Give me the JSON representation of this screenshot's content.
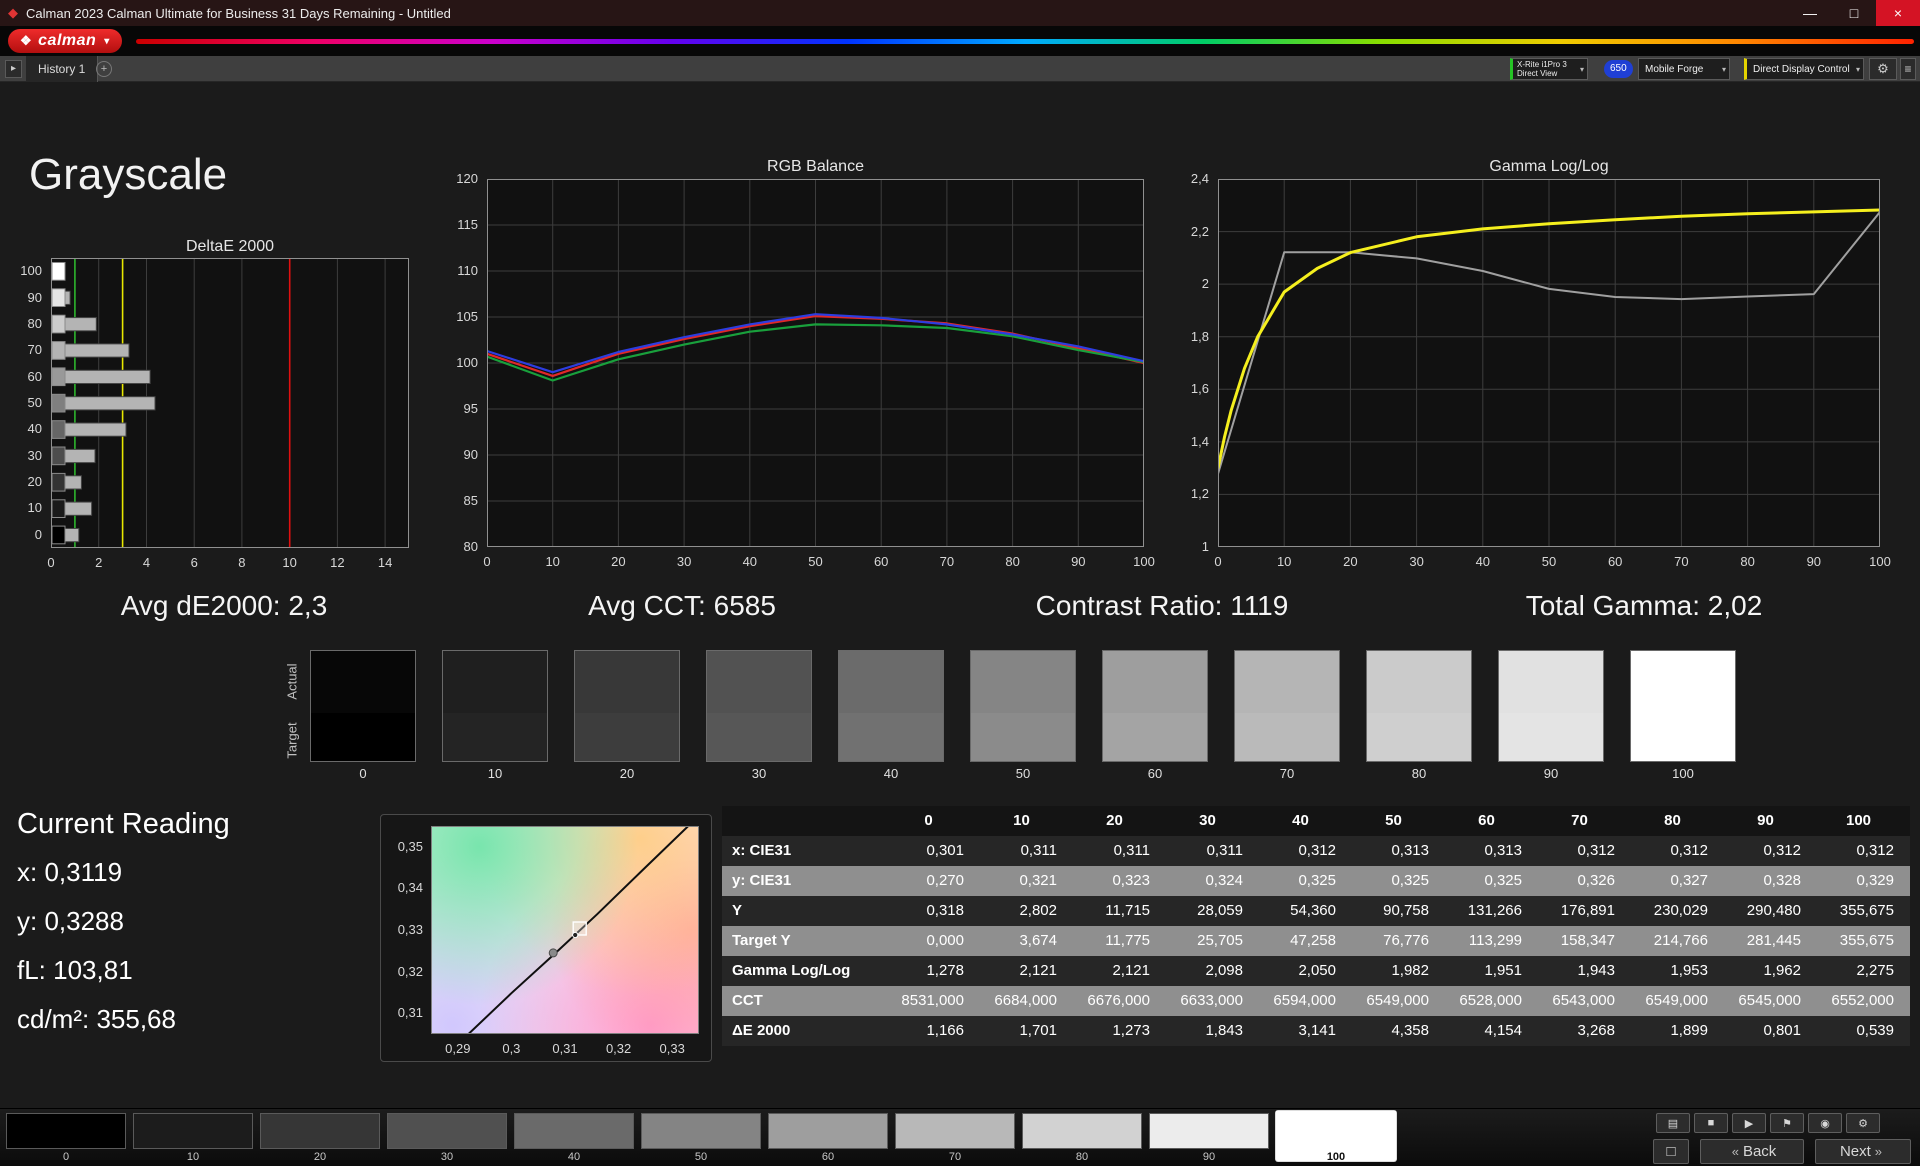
{
  "window": {
    "title": "Calman 2023 Calman Ultimate for Business 31 Days Remaining  - Untitled",
    "icon_glyph": "◆",
    "minimize_glyph": "—",
    "maximize_glyph": "□",
    "close_glyph": "×"
  },
  "brand": {
    "logo_text": "calman",
    "logo_icon": "❖",
    "logo_color": "#d11a1a",
    "dropdown_glyph": "▾"
  },
  "tabbar": {
    "nav_glyph": "▸",
    "history_tab": "History 1",
    "add_glyph": "+",
    "meter_line1": "X-Rite i1Pro 3",
    "meter_line2": "Direct View",
    "meter_accent": "#25c325",
    "badge": "650",
    "source_label": "Mobile Forge",
    "display_control_label": "Direct Display Control",
    "display_control_accent": "#e4d300",
    "dropdown_glyph": "▾",
    "gear_glyph": "⚙",
    "menu_glyph": "≡"
  },
  "page": {
    "title": "Grayscale"
  },
  "summary": {
    "de2000": "Avg dE2000: 2,3",
    "cct": "Avg CCT: 6585",
    "contrast": "Contrast Ratio: 1119",
    "gamma": "Total Gamma: 2,02"
  },
  "current_reading": {
    "title": "Current Reading",
    "x": "x: 0,3119",
    "y": "y: 0,3288",
    "fl": "fL: 103,81",
    "cdm2": "cd/m²: 355,68"
  },
  "swatches": {
    "row_labels": [
      "Actual",
      "Target"
    ],
    "items": [
      {
        "label": "0",
        "actual": "#070707",
        "target": "#000000"
      },
      {
        "label": "10",
        "actual": "#1f1f1f",
        "target": "#242424"
      },
      {
        "label": "20",
        "actual": "#383838",
        "target": "#3d3d3d"
      },
      {
        "label": "30",
        "actual": "#525252",
        "target": "#575757"
      },
      {
        "label": "40",
        "actual": "#6b6b6b",
        "target": "#717171"
      },
      {
        "label": "50",
        "actual": "#858585",
        "target": "#8b8b8b"
      },
      {
        "label": "60",
        "actual": "#9e9e9e",
        "target": "#a4a4a4"
      },
      {
        "label": "70",
        "actual": "#b5b5b5",
        "target": "#bababa"
      },
      {
        "label": "80",
        "actual": "#cbcbcb",
        "target": "#cfcfcf"
      },
      {
        "label": "90",
        "actual": "#e1e1e1",
        "target": "#e4e4e4"
      },
      {
        "label": "100",
        "actual": "#ffffff",
        "target": "#ffffff"
      }
    ]
  },
  "table": {
    "columns": [
      "0",
      "10",
      "20",
      "30",
      "40",
      "50",
      "60",
      "70",
      "80",
      "90",
      "100"
    ],
    "rows": [
      {
        "label": "x: CIE31",
        "values": [
          "0,301",
          "0,311",
          "0,311",
          "0,311",
          "0,312",
          "0,313",
          "0,313",
          "0,312",
          "0,312",
          "0,312",
          "0,312"
        ]
      },
      {
        "label": "y: CIE31",
        "values": [
          "0,270",
          "0,321",
          "0,323",
          "0,324",
          "0,325",
          "0,325",
          "0,325",
          "0,326",
          "0,327",
          "0,328",
          "0,329"
        ]
      },
      {
        "label": "Y",
        "values": [
          "0,318",
          "2,802",
          "11,715",
          "28,059",
          "54,360",
          "90,758",
          "131,266",
          "176,891",
          "230,029",
          "290,480",
          "355,675"
        ]
      },
      {
        "label": "Target Y",
        "values": [
          "0,000",
          "3,674",
          "11,775",
          "25,705",
          "47,258",
          "76,776",
          "113,299",
          "158,347",
          "214,766",
          "281,445",
          "355,675"
        ]
      },
      {
        "label": "Gamma Log/Log",
        "values": [
          "1,278",
          "2,121",
          "2,121",
          "2,098",
          "2,050",
          "1,982",
          "1,951",
          "1,943",
          "1,953",
          "1,962",
          "2,275"
        ]
      },
      {
        "label": "CCT",
        "values": [
          "8531,000",
          "6684,000",
          "6676,000",
          "6633,000",
          "6594,000",
          "6549,000",
          "6528,000",
          "6543,000",
          "6549,000",
          "6545,000",
          "6552,000"
        ]
      },
      {
        "label": "ΔE 2000",
        "values": [
          "1,166",
          "1,701",
          "1,273",
          "1,843",
          "3,141",
          "4,358",
          "4,154",
          "3,268",
          "1,899",
          "0,801",
          "0,539"
        ]
      }
    ]
  },
  "bottom_bar": {
    "patches": [
      {
        "label": "0",
        "color": "#000000"
      },
      {
        "label": "10",
        "color": "#1c1c1c"
      },
      {
        "label": "20",
        "color": "#363636"
      },
      {
        "label": "30",
        "color": "#505050"
      },
      {
        "label": "40",
        "color": "#6a6a6a"
      },
      {
        "label": "50",
        "color": "#848484"
      },
      {
        "label": "60",
        "color": "#9e9e9e"
      },
      {
        "label": "70",
        "color": "#b8b8b8"
      },
      {
        "label": "80",
        "color": "#d2d2d2"
      },
      {
        "label": "90",
        "color": "#ececec"
      },
      {
        "label": "100",
        "color": "#ffffff",
        "selected": true
      }
    ],
    "icons": [
      {
        "name": "patch-grid",
        "glyph": "▤"
      },
      {
        "name": "stop",
        "glyph": "■"
      },
      {
        "name": "play",
        "glyph": "▶"
      },
      {
        "name": "flag",
        "glyph": "⚑"
      },
      {
        "name": "record",
        "glyph": "◉"
      },
      {
        "name": "settings",
        "glyph": "⚙"
      }
    ],
    "window_button_glyph": "□",
    "back_icon": "«",
    "back_label": "Back",
    "next_label": "Next",
    "next_icon": "»"
  },
  "chart_data": [
    {
      "id": "deltae",
      "type": "bar",
      "orientation": "horizontal",
      "title": "DeltaE 2000",
      "categories": [
        100,
        90,
        80,
        70,
        60,
        50,
        40,
        30,
        20,
        10,
        0
      ],
      "values": [
        0.539,
        0.801,
        1.899,
        3.268,
        4.154,
        4.358,
        3.141,
        1.843,
        1.273,
        1.701,
        1.166
      ],
      "xlim": [
        0,
        15
      ],
      "xticks": [
        0,
        2,
        4,
        6,
        8,
        10,
        12,
        14
      ],
      "reference_lines": [
        {
          "x": 1,
          "color": "#2db52d"
        },
        {
          "x": 3,
          "color": "#e8e800"
        },
        {
          "x": 10,
          "color": "#e01010"
        }
      ]
    },
    {
      "id": "rgb_balance",
      "type": "line",
      "title": "RGB Balance",
      "x": [
        0,
        10,
        20,
        30,
        40,
        50,
        60,
        70,
        80,
        90,
        100
      ],
      "ylim": [
        80,
        120
      ],
      "yticks": [
        80,
        85,
        90,
        95,
        100,
        105,
        110,
        115,
        120
      ],
      "series": [
        {
          "name": "Red",
          "color": "#e02828",
          "stroke_width": 2.2,
          "values": [
            101.0,
            98.6,
            101.0,
            102.6,
            104.0,
            105.1,
            104.8,
            104.3,
            103.2,
            101.6,
            100.0
          ]
        },
        {
          "name": "Green",
          "color": "#19a03c",
          "stroke_width": 2.2,
          "values": [
            100.7,
            98.1,
            100.4,
            102.0,
            103.4,
            104.2,
            104.1,
            103.8,
            102.9,
            101.4,
            100.1
          ]
        },
        {
          "name": "Blue",
          "color": "#2d3de0",
          "stroke_width": 2.2,
          "values": [
            101.3,
            99.0,
            101.2,
            102.8,
            104.2,
            105.3,
            104.9,
            104.2,
            103.1,
            101.8,
            100.2
          ]
        }
      ]
    },
    {
      "id": "gamma",
      "type": "line",
      "title": "Gamma Log/Log",
      "x": [
        0,
        10,
        20,
        30,
        40,
        50,
        60,
        70,
        80,
        90,
        100
      ],
      "ylim": [
        1,
        2.4
      ],
      "yticks": [
        1,
        1.2,
        1.4,
        1.6,
        1.8,
        2,
        2.2,
        2.4
      ],
      "ytick_labels": [
        "1",
        "1,2",
        "1,4",
        "1,6",
        "1,8",
        "2",
        "2,2",
        "2,4"
      ],
      "series": [
        {
          "name": "Measured Gamma",
          "color": "#a0a0a0",
          "stroke_width": 2,
          "values": [
            1.278,
            2.121,
            2.121,
            2.098,
            2.05,
            1.982,
            1.951,
            1.943,
            1.953,
            1.962,
            2.275
          ]
        },
        {
          "name": "Target Gamma",
          "color": "#f5ef1e",
          "stroke_width": 3,
          "x": [
            0,
            1,
            2,
            4,
            6,
            10,
            15,
            20,
            30,
            40,
            50,
            60,
            70,
            80,
            90,
            100
          ],
          "values": [
            1.3,
            1.42,
            1.52,
            1.68,
            1.8,
            1.97,
            2.06,
            2.12,
            2.18,
            2.21,
            2.23,
            2.245,
            2.258,
            2.268,
            2.275,
            2.282
          ]
        }
      ]
    },
    {
      "id": "cie_chromaticity",
      "type": "scatter",
      "title": "",
      "xlim": [
        0.285,
        0.335
      ],
      "ylim": [
        0.305,
        0.355
      ],
      "xticks": [
        0.29,
        0.3,
        0.31,
        0.32,
        0.33
      ],
      "xtick_labels": [
        "0,29",
        "0,3",
        "0,31",
        "0,32",
        "0,33"
      ],
      "yticks": [
        0.31,
        0.32,
        0.33,
        0.34,
        0.35
      ],
      "ytick_labels": [
        "0,31",
        "0,32",
        "0,33",
        "0,34",
        "0,35"
      ],
      "measured_point": {
        "x": 0.3119,
        "y": 0.3288
      },
      "reference_point": {
        "x": 0.3078,
        "y": 0.3245
      },
      "locus": [
        [
          0.292,
          0.305
        ],
        [
          0.3,
          0.3148
        ],
        [
          0.308,
          0.3242
        ],
        [
          0.316,
          0.3338
        ],
        [
          0.324,
          0.3438
        ],
        [
          0.333,
          0.355
        ]
      ]
    }
  ]
}
